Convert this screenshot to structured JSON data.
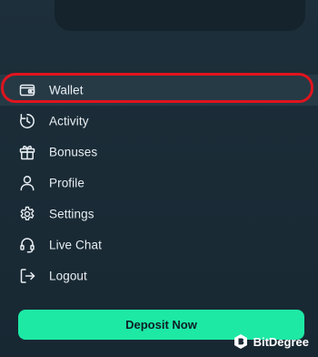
{
  "menu": {
    "items": [
      {
        "label": "Wallet",
        "icon": "wallet-icon"
      },
      {
        "label": "Activity",
        "icon": "activity-clock-icon"
      },
      {
        "label": "Bonuses",
        "icon": "gift-icon"
      },
      {
        "label": "Profile",
        "icon": "user-icon"
      },
      {
        "label": "Settings",
        "icon": "gear-icon"
      },
      {
        "label": "Live Chat",
        "icon": "headset-icon"
      },
      {
        "label": "Logout",
        "icon": "logout-icon"
      }
    ]
  },
  "deposit_label": "Deposit Now",
  "watermark": {
    "text": "BitDegree"
  },
  "colors": {
    "background": "#1b2c37",
    "accent": "#1de9a5",
    "highlight": "#e0141e",
    "text": "#e8eef2"
  }
}
